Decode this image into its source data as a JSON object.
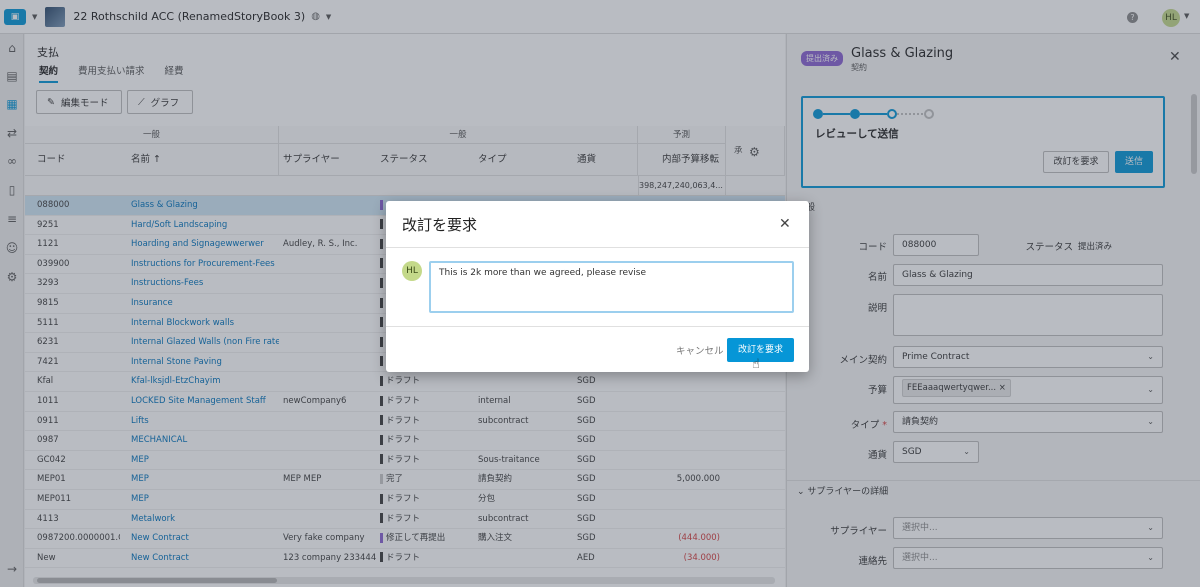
{
  "topbar": {
    "project_name": "22 Rothschild ACC (RenamedStoryBook 3)",
    "avatar_initials": "HL"
  },
  "main": {
    "page_title": "支払",
    "tabs": [
      {
        "label": "契約"
      },
      {
        "label": "費用支払い請求"
      },
      {
        "label": "経費"
      }
    ],
    "edit_mode_label": "編集モード",
    "chart_label": "グラフ",
    "group_headers": [
      "一般",
      "一般",
      "予測",
      "承"
    ],
    "columns": [
      "コード",
      "名前 ↑",
      "サプライヤー",
      "ステータス",
      "タイプ",
      "通貨",
      "内部予算移転"
    ],
    "summary_value": "398,247,240,063,4...",
    "rows": [
      {
        "code": "088000",
        "name": "Glass & Glazing",
        "supplier": "",
        "status": "",
        "type": "",
        "currency": "",
        "amount": ""
      },
      {
        "code": "9251",
        "name": "Hard/Soft Landscaping",
        "supplier": "",
        "status": "",
        "type": "",
        "currency": "",
        "amount": ""
      },
      {
        "code": "1121",
        "name": "Hoarding and Signagewwerwer",
        "supplier": "Audley, R. S., Inc.",
        "status": "",
        "type": "",
        "currency": "",
        "amount": ""
      },
      {
        "code": "039900",
        "name": "Instructions for Procurement-Fees",
        "supplier": "",
        "status": "",
        "type": "",
        "currency": "",
        "amount": ""
      },
      {
        "code": "3293",
        "name": "Instructions-Fees",
        "supplier": "",
        "status": "",
        "type": "",
        "currency": "",
        "amount": ""
      },
      {
        "code": "9815",
        "name": "Insurance",
        "supplier": "",
        "status": "",
        "type": "",
        "currency": "",
        "amount": ""
      },
      {
        "code": "5111",
        "name": "Internal Blockwork walls",
        "supplier": "",
        "status": "",
        "type": "",
        "currency": "",
        "amount": ""
      },
      {
        "code": "6231",
        "name": "Internal Glazed Walls (non Fire rate...",
        "supplier": "",
        "status": "",
        "type": "",
        "currency": "",
        "amount": ""
      },
      {
        "code": "7421",
        "name": "Internal Stone Paving",
        "supplier": "",
        "status": "",
        "type": "",
        "currency": "",
        "amount": ""
      },
      {
        "code": "Kfal",
        "name": "Kfal-lksjdl-EtzChayim",
        "supplier": "",
        "status": "ドラフト",
        "type": "",
        "currency": "SGD",
        "amount": ""
      },
      {
        "code": "1011",
        "name": "LOCKED Site Management Staff",
        "supplier": "newCompany6",
        "status": "ドラフト",
        "type": "internal",
        "currency": "SGD",
        "amount": ""
      },
      {
        "code": "0911",
        "name": "Lifts",
        "supplier": "",
        "status": "ドラフト",
        "type": "subcontract",
        "currency": "SGD",
        "amount": ""
      },
      {
        "code": "0987",
        "name": "MECHANICAL",
        "supplier": "",
        "status": "ドラフト",
        "type": "",
        "currency": "SGD",
        "amount": ""
      },
      {
        "code": "GC042",
        "name": "MEP",
        "supplier": "",
        "status": "ドラフト",
        "type": "Sous-traitance",
        "currency": "SGD",
        "amount": ""
      },
      {
        "code": "MEP01",
        "name": "MEP",
        "supplier": "MEP MEP",
        "status": "完了",
        "type": "請負契約",
        "currency": "SGD",
        "amount": "5,000.000"
      },
      {
        "code": "MEP011",
        "name": "MEP",
        "supplier": "",
        "status": "ドラフト",
        "type": "分包",
        "currency": "SGD",
        "amount": ""
      },
      {
        "code": "4113",
        "name": "Metalwork",
        "supplier": "",
        "status": "ドラフト",
        "type": "subcontract",
        "currency": "SGD",
        "amount": ""
      },
      {
        "code": "0987200.0000001.G...",
        "name": "New Contract",
        "supplier": "Very fake company",
        "status": "修正して再提出",
        "type": "購入注文",
        "currency": "SGD",
        "amount": "(444.000)"
      },
      {
        "code": "New",
        "name": "New Contract",
        "supplier": "123 company 2334445",
        "status": "ドラフト",
        "type": "",
        "currency": "AED",
        "amount": "(34.000)"
      }
    ]
  },
  "right_panel": {
    "badge": "提出済み",
    "title": "Glass & Glazing",
    "subtitle": "契約",
    "workflow_label": "レビューして送信",
    "request_revision_label": "改訂を要求",
    "send_label": "送信",
    "general_section": "一般",
    "code_label": "コード",
    "code_value": "088000",
    "status_label": "ステータス",
    "status_value": "提出済み",
    "name_label": "名前",
    "name_value": "Glass & Glazing",
    "description_label": "説明",
    "main_contract_label": "メイン契約",
    "main_contract_value": "Prime Contract",
    "budget_label": "予算",
    "budget_chip": "FEEaaaqwertyqwer...",
    "type_label": "タイプ",
    "type_value": "請負契約",
    "currency_label": "通貨",
    "currency_value": "SGD",
    "supplier_section": "サプライヤーの詳細",
    "supplier_label": "サプライヤー",
    "supplier_placeholder": "選択中...",
    "contact_label": "連絡先",
    "contact_placeholder": "選択中..."
  },
  "modal": {
    "title": "改訂を要求",
    "avatar_initials": "HL",
    "comment_value": "This is 2k more than we agreed, please revise",
    "cancel_label": "キャンセル",
    "submit_label": "改訂を要求"
  },
  "colors": {
    "accent": "#0696d7",
    "submitted_badge": "#8a63d2",
    "negative": "#d43c3c"
  }
}
